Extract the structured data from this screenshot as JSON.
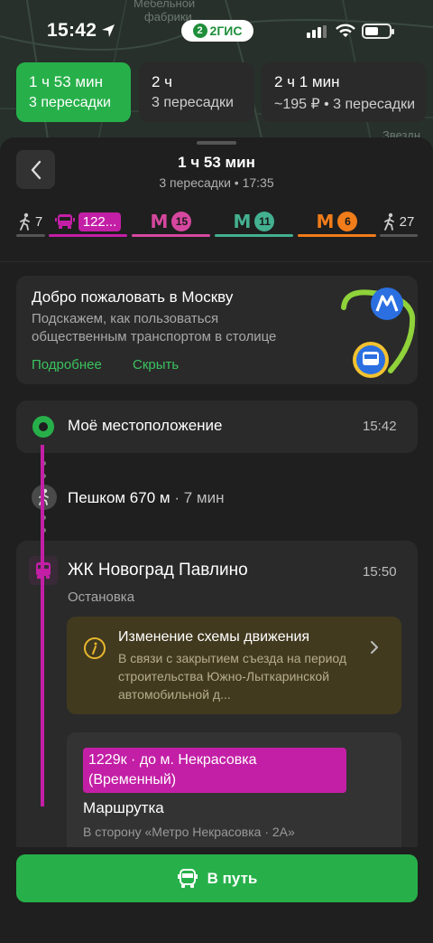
{
  "map": {
    "labels": [
      "Мебельной",
      "фабрики",
      "Звездн"
    ]
  },
  "status_bar": {
    "time": "15:42",
    "app_pill": "2ГИС",
    "app_pill_icon": "2"
  },
  "route_options": [
    {
      "time": "1 ч 53 мин",
      "details": "3 пересадки",
      "active": true
    },
    {
      "time": "2 ч",
      "details": "3 пересадки",
      "active": false
    },
    {
      "time": "2 ч 1 мин",
      "details": "~195 ₽ • 3 пересадки",
      "active": false
    }
  ],
  "header": {
    "title": "1 ч 53 мин",
    "subtitle": "3 пересадки • 17:35"
  },
  "legs": [
    {
      "kind": "walk",
      "value": "7"
    },
    {
      "kind": "bus",
      "value": "122..."
    },
    {
      "kind": "metro",
      "value": "15",
      "color": "#d6479f"
    },
    {
      "kind": "metro",
      "value": "11",
      "color": "#43b08f"
    },
    {
      "kind": "metro",
      "value": "6",
      "color": "#f07c1a"
    },
    {
      "kind": "walk",
      "value": "27"
    }
  ],
  "metro_symbol": "М",
  "welcome": {
    "title": "Добро пожаловать в Москву",
    "text": "Подскажем, как пользоваться общественным транспортом в столице",
    "more": "Подробнее",
    "hide": "Скрыть"
  },
  "start": {
    "label": "Моё местоположение",
    "time": "15:42"
  },
  "walk": {
    "label": "Пешком 670 м",
    "duration": " · 7 мин"
  },
  "stop": {
    "name": "ЖК Новоград Павлино",
    "time": "15:50",
    "type": "Остановка",
    "notice_title": "Изменение схемы движения",
    "notice_text": "В связи с закрытием съезда на период строительства Южно-Лыткаринской автомобильной д...",
    "route_badge": "1229к · до м. Некрасовка (Временный)",
    "route_type": "Маршрутка",
    "route_direction": "В сторону «Метро Некрасовка · 2А»"
  },
  "go_button": "В путь",
  "colors": {
    "accent": "#27b04a",
    "bus": "#c31fa6"
  }
}
